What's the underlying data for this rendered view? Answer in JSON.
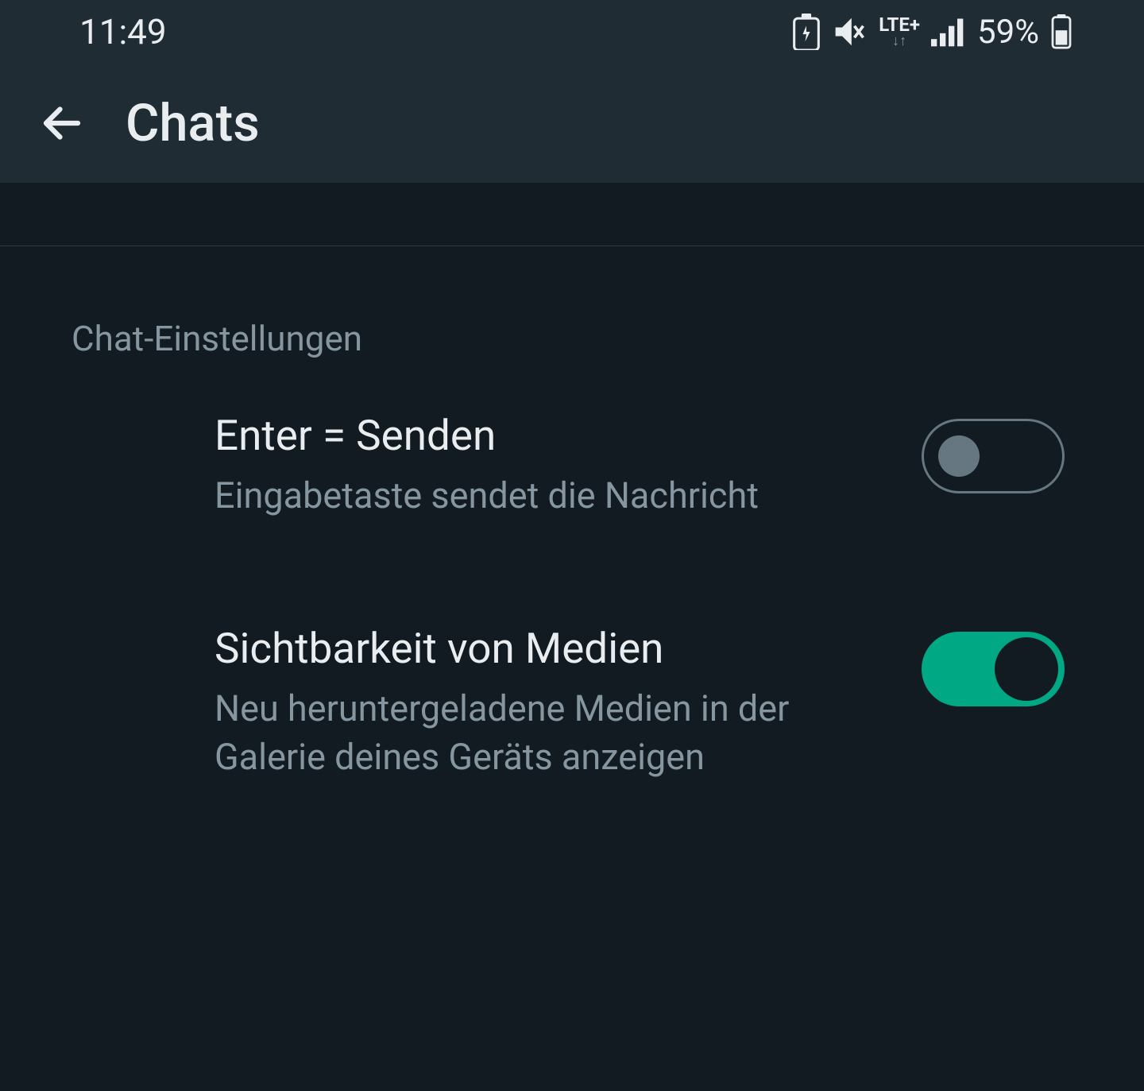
{
  "status": {
    "time": "11:49",
    "network_label": "LTE+",
    "battery_percent": "59%"
  },
  "header": {
    "title": "Chats"
  },
  "section": {
    "label": "Chat-Einstellungen"
  },
  "settings": {
    "enter_send": {
      "title": "Enter = Senden",
      "desc": "Eingabetaste sendet die Nachricht",
      "enabled": false
    },
    "media_visibility": {
      "title": "Sichtbarkeit von Medien",
      "desc": "Neu heruntergeladene Medien in der Galerie deines Geräts anzeigen",
      "enabled": true
    }
  }
}
